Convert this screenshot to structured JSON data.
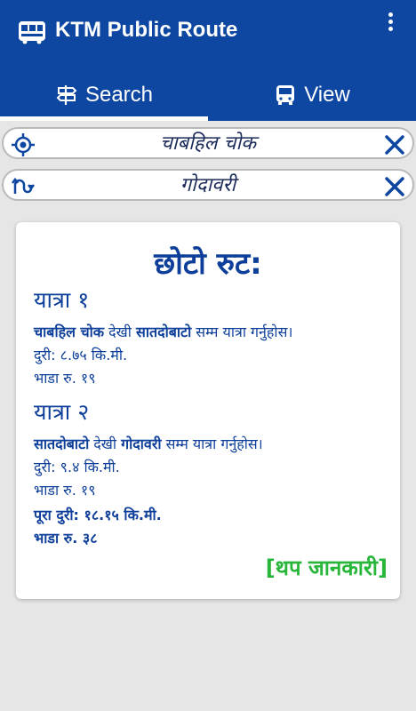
{
  "app": {
    "title": "KTM Public Route",
    "colors": {
      "primary": "#0d47a1",
      "accent_green": "#27b53a",
      "text_blue": "#0d3f9a"
    }
  },
  "tabs": [
    {
      "label": "Search",
      "icon": "signpost-icon",
      "selected": true
    },
    {
      "label": "View",
      "icon": "bus-icon",
      "selected": false
    }
  ],
  "from_field": {
    "value": "चाबहिल चोक",
    "icon": "target-icon"
  },
  "to_field": {
    "value": "गोदावरी",
    "icon": "route-icon"
  },
  "result": {
    "heading": "छोटो रुट:",
    "trip1": {
      "title": "यात्रा १",
      "from": "चाबहिल चोक",
      "dekhi": " देखी ",
      "to": "सातदोबाटो",
      "suffix": " सम्म यात्रा गर्नुहोस।",
      "distance": "दुरी: ८.७५ कि.मी.",
      "fare": "भाडा रु. १९"
    },
    "trip2": {
      "title": "यात्रा २",
      "from": "सातदोबाटो",
      "dekhi": " देखी ",
      "to": "गोदावरी",
      "suffix": " सम्म यात्रा गर्नुहोस।",
      "distance": "दुरी: ९.४ कि.मी.",
      "fare": "भाडा रु. १९"
    },
    "total_distance": "पूरा दुरी: १८.१५ कि.मी.",
    "total_fare": "भाडा रु. ३८",
    "more_info": "[थप जानकारी]"
  }
}
